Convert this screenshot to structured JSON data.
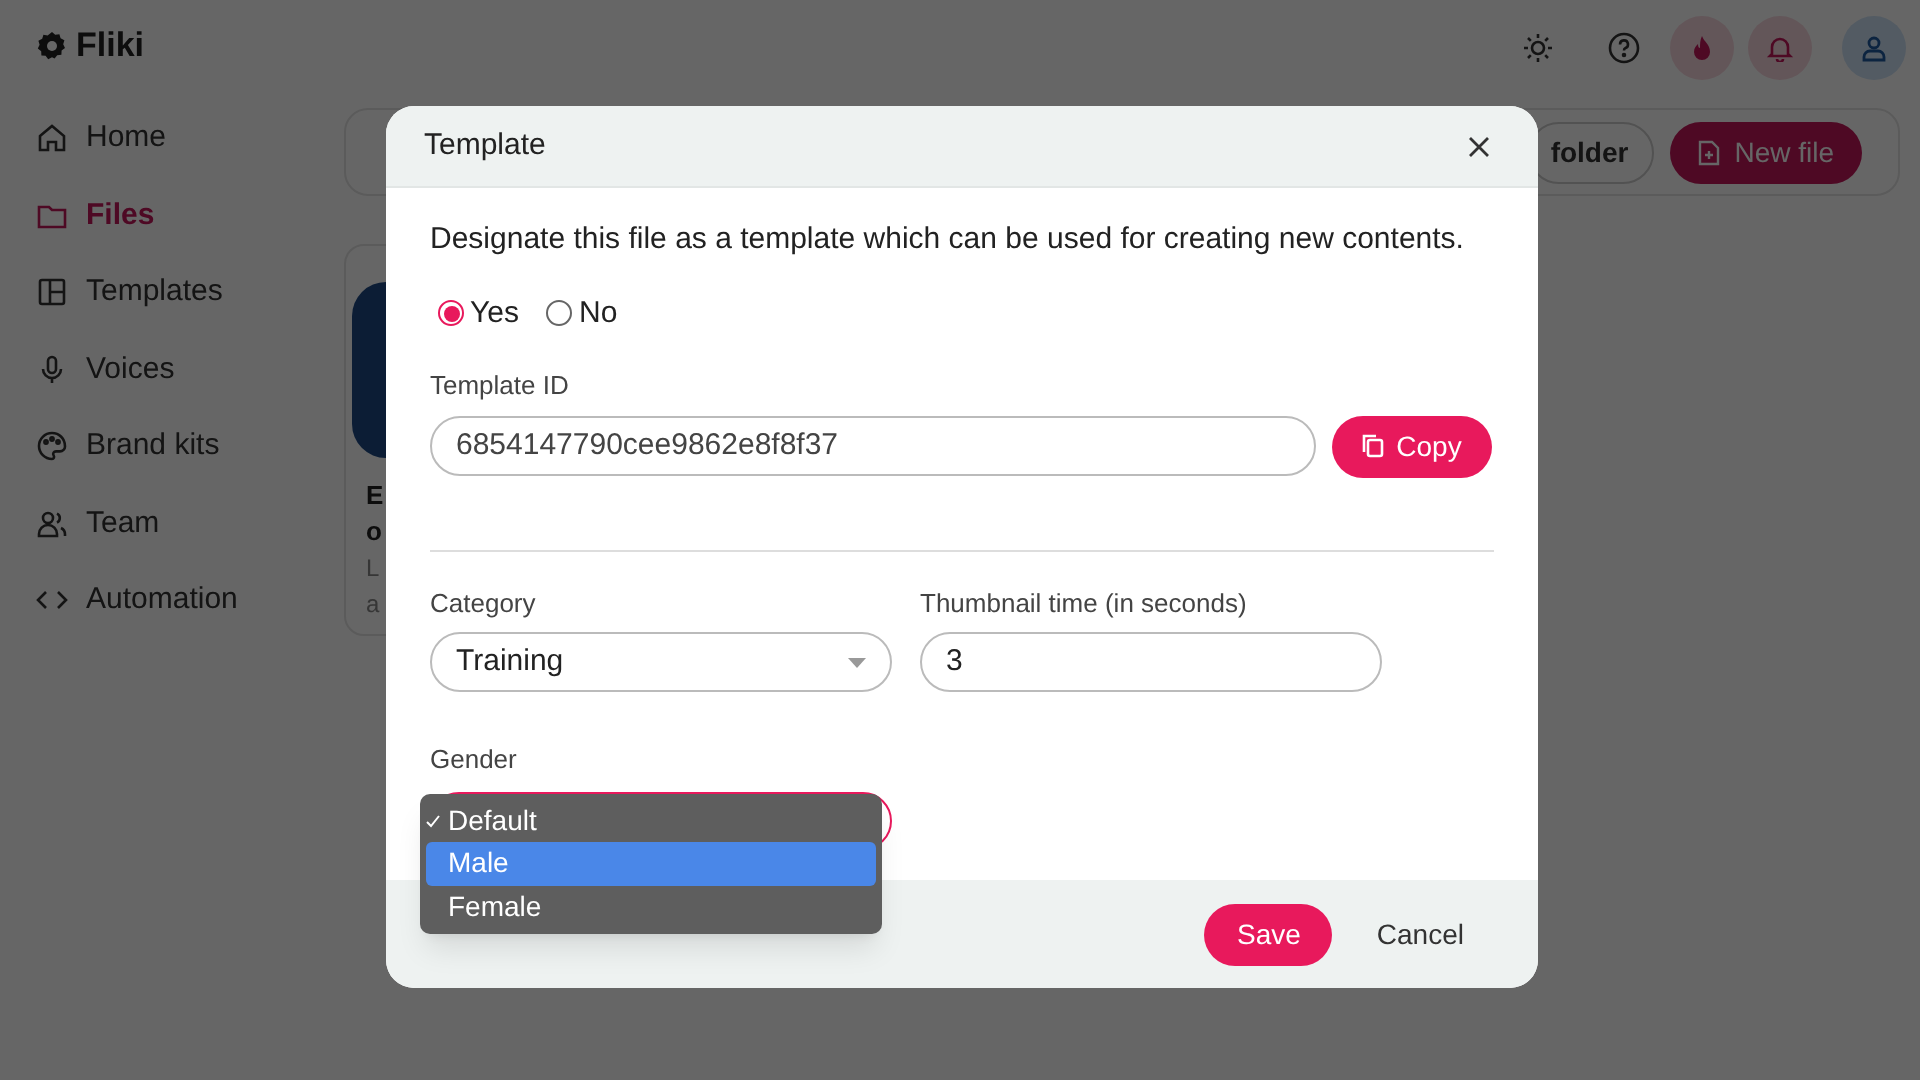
{
  "app": {
    "logo": "Fliki"
  },
  "sidebar": {
    "items": [
      {
        "label": "Home",
        "selected": false
      },
      {
        "label": "Files",
        "selected": true
      },
      {
        "label": "Templates",
        "selected": false
      },
      {
        "label": "Voices",
        "selected": false
      },
      {
        "label": "Brand kits",
        "selected": false
      },
      {
        "label": "Team",
        "selected": false
      },
      {
        "label": "Automation",
        "selected": false
      }
    ]
  },
  "toolbar": {
    "buttons": [
      {
        "label": "folder",
        "kind": "outline"
      },
      {
        "label": "New file",
        "kind": "primary"
      }
    ]
  },
  "card": {
    "lines": [
      {
        "text": "E",
        "kind": "title"
      },
      {
        "text": "o",
        "kind": "title"
      },
      {
        "text": "L",
        "kind": "meta"
      },
      {
        "text": "a",
        "kind": "meta"
      }
    ]
  },
  "dialog": {
    "title": "Template",
    "description": "Designate this file as a template which can be used for creating new contents.",
    "template_radio": [
      {
        "label": "Yes",
        "selected": true
      },
      {
        "label": "No",
        "selected": false
      }
    ],
    "template_id": {
      "label": "Template ID",
      "value": "6854147790cee9862e8f8f37",
      "copy_button": "Copy"
    },
    "category": {
      "label": "Category",
      "value": "Training"
    },
    "thumbnail_time": {
      "label": "Thumbnail time (in seconds)",
      "value": "3"
    },
    "gender": {
      "label": "Gender",
      "options": [
        {
          "label": "Default",
          "checked": true,
          "highlighted": false
        },
        {
          "label": "Male",
          "checked": false,
          "highlighted": true
        },
        {
          "label": "Female",
          "checked": false,
          "highlighted": false
        }
      ]
    },
    "buttons": {
      "save": "Save",
      "cancel": "Cancel"
    }
  }
}
